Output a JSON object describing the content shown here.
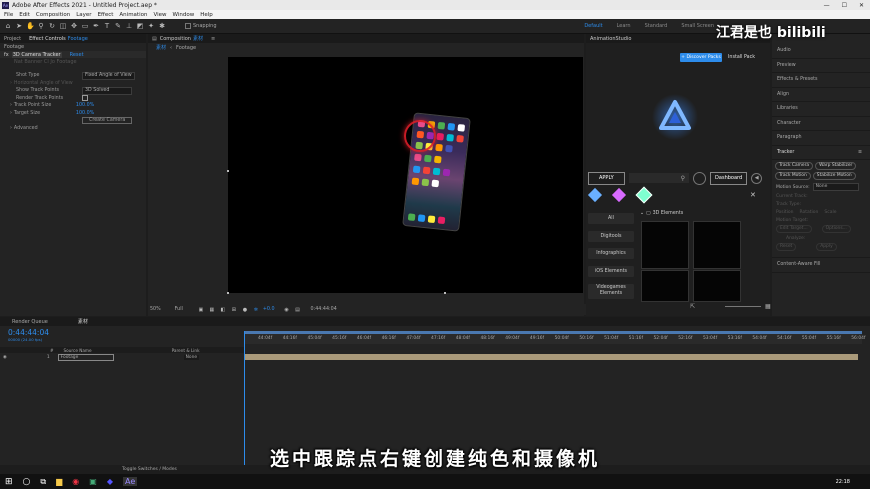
{
  "titlebar": {
    "title": "Adobe After Effects 2021 - Untitled Project.aep *"
  },
  "menu": [
    "File",
    "Edit",
    "Composition",
    "Layer",
    "Effect",
    "Animation",
    "View",
    "Window",
    "Help"
  ],
  "toolbar": {
    "snapping": "Snapping",
    "workspaces": [
      "Default",
      "Learn",
      "Standard",
      "Small Screen"
    ],
    "active_workspace": "Default"
  },
  "effects_panel": {
    "tabs": [
      "Project",
      "Effect Controls",
      "Footage"
    ],
    "layer": "Footage",
    "effect_name": "3D Camera Tracker",
    "reset": "Reset",
    "header_sub": "Nat Banner Cl Jo Footage",
    "rows": [
      {
        "label": "Shot Type",
        "value": "Fixed Angle of View"
      },
      {
        "label": "Horizontal Angle of View",
        "value": ""
      },
      {
        "label": "Show Track Points",
        "value": "3D Solved"
      },
      {
        "label": "Render Track Points",
        "value": ""
      },
      {
        "label": "Track Point Size",
        "value": "100.0%"
      },
      {
        "label": "Target Size",
        "value": "100.0%"
      }
    ],
    "create_camera": "Create Camera",
    "advanced": "Advanced"
  },
  "composition": {
    "tab": "Composition",
    "tab_name": "素材",
    "breadcrumb": [
      "素材",
      "Footage"
    ],
    "footer": {
      "zoom": "50%",
      "quality": "Full",
      "exposure": "+0.0",
      "timecode": "0:44:44:04"
    }
  },
  "animation_studio": {
    "title": "AnimationStudio",
    "discover": "+ Discover Packs",
    "install": "Install Pack",
    "apply": "APPLY",
    "dashboard": "Dashboard",
    "categories": [
      "All",
      "Digitools",
      "Infographics",
      "iOS Elements",
      "Videogames Elements"
    ],
    "group": "3D Elements"
  },
  "right_panel": {
    "items": [
      "Audio",
      "Preview",
      "Effects & Presets",
      "Align",
      "Libraries",
      "Character",
      "Paragraph",
      "Tracker"
    ],
    "tracker_buttons": [
      "Track Camera",
      "Warp Stabilizer",
      "Track Motion",
      "Stabilize Motion"
    ],
    "motion_source_label": "Motion Source:",
    "motion_source": "None",
    "current_track": "Current Track:",
    "track_type": "Track Type:",
    "checkboxes": [
      "Position",
      "Rotation",
      "Scale"
    ],
    "motion_target": "Motion Target:",
    "edit_target": "Edit Target...",
    "options": "Options...",
    "analyze": "Analyze:",
    "reset": "Reset",
    "apply": "Apply",
    "content_aware": "Content-Aware Fill"
  },
  "timeline": {
    "tabs": [
      "Render Queue",
      "素材"
    ],
    "timecode": "0:44:44:04",
    "timecode_sub": "00000 (24.00 fps)",
    "columns": [
      "#",
      "Source Name",
      "Parent & Link"
    ],
    "layer": {
      "index": "1",
      "name": "Footage",
      "parent": "None"
    },
    "ruler": [
      "44:04f",
      "44:16f",
      "45:04f",
      "45:16f",
      "46:04f",
      "46:16f",
      "47:04f",
      "47:16f",
      "48:04f",
      "48:16f",
      "49:04f",
      "49:16f",
      "50:04f",
      "50:16f",
      "51:04f",
      "51:16f",
      "52:04f",
      "52:16f",
      "53:04f",
      "53:16f",
      "54:04f",
      "54:16f",
      "55:04f",
      "55:16f",
      "56:04f"
    ],
    "toggle": "Toggle Switches / Modes"
  },
  "subtitle": "选中跟踪点右键创建纯色和摄像机",
  "watermark": "江君是也 bilibili",
  "taskbar": {
    "time": "22:18"
  },
  "colors": {
    "accent": "#2d8ceb",
    "bg": "#232323"
  }
}
